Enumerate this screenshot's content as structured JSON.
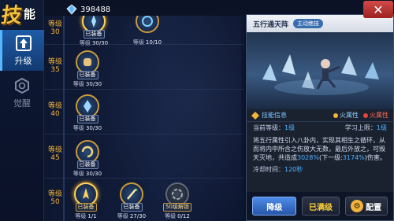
{
  "header": {
    "title_big": "技",
    "title_small": "能",
    "diamond_icon": "diamond-icon",
    "diamond_count": "398488"
  },
  "sidebar": {
    "items": [
      {
        "label": "升级",
        "icon": "upgrade-icon",
        "active": true
      },
      {
        "label": "觉醒",
        "icon": "hexagon-icon",
        "active": false
      }
    ]
  },
  "skill_list": {
    "level_label_prefix": "等级",
    "rows": [
      {
        "level": "30",
        "skills": [
          {
            "tag": "已装备",
            "level_label": "等级",
            "level_value": "30/30"
          },
          {
            "tag": "",
            "level_label": "等级",
            "level_value": "10/10"
          }
        ]
      },
      {
        "level": "35",
        "skills": [
          {
            "tag": "已装备",
            "level_label": "等级",
            "level_value": "30/30"
          }
        ]
      },
      {
        "level": "40",
        "skills": [
          {
            "tag": "已装备",
            "level_label": "等级",
            "level_value": "30/30"
          }
        ]
      },
      {
        "level": "45",
        "skills": [
          {
            "tag": "已装备",
            "level_label": "等级",
            "level_value": "30/30"
          }
        ]
      },
      {
        "level": "50",
        "skills": [
          {
            "tag": "已装备",
            "level_label": "等级",
            "level_value": "1/1"
          },
          {
            "tag": "已装备",
            "level_label": "等级",
            "level_value": "27/30"
          },
          {
            "tag": "50级解锁",
            "level_label": "等级",
            "level_value": "0/12"
          }
        ]
      }
    ]
  },
  "detail": {
    "skill_name": "五行通天阵",
    "skill_type": "主动绝技",
    "close_icon": "close-icon",
    "info_title": "技能信息",
    "attr1": "火属性",
    "attr2": "火属性",
    "current_level_label": "当前等级：",
    "current_level_value": "1级",
    "learn_limit_label": "学习上限：",
    "learn_limit_value": "1级",
    "desc_1": "将五行属性引入八卦内，实现其相生之循环，从而将内中所含之伤放大无数，最后外放之，可毁天灭地，共造成",
    "desc_pct1": "3028%",
    "desc_2": "(下一级:",
    "desc_pct2": "3174%",
    "desc_3": ")伤害。",
    "cooldown_label": "冷却时间：",
    "cooldown_value": "120秒",
    "btn_down": "降级",
    "btn_max": "已满级",
    "btn_config": "配置"
  },
  "colors": {
    "accent_gold": "#f2b43a",
    "accent_blue": "#4fb1ff",
    "panel_bg": "#1a2230",
    "close_red": "#c23a38"
  }
}
